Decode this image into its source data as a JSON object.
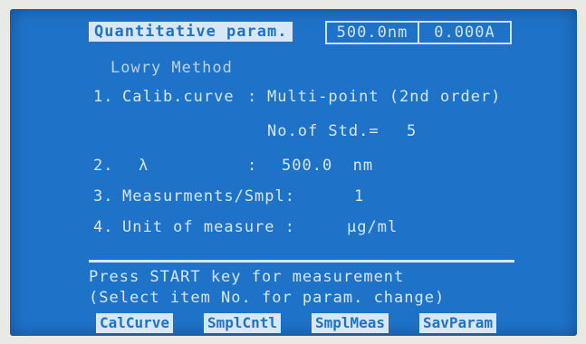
{
  "header": {
    "title": "Quantitative param.",
    "wavelength_status": "500.0nm",
    "absorbance_status": "0.000A"
  },
  "method_name": "Lowry Method",
  "params": [
    {
      "number": "1.",
      "label": "Calib.curve",
      "separator": ":",
      "value": "Multi-point (2nd order)"
    },
    {
      "number": "",
      "label": "No.of Std.=",
      "separator": "",
      "value": "5"
    },
    {
      "number": "2.",
      "label": "λ",
      "separator": ":",
      "value": "500.0  nm"
    },
    {
      "number": "3.",
      "label": "Measurments/Smpl:",
      "separator": "",
      "value": "1"
    },
    {
      "number": "4.",
      "label": "Unit of measure :",
      "separator": "",
      "value": "μg/ml"
    }
  ],
  "messages": [
    "Press START key for measurement",
    "(Select item No. for param. change)"
  ],
  "softkeys": [
    "CalCurve",
    "SmplCntl",
    "SmplMeas",
    "SavParam"
  ]
}
